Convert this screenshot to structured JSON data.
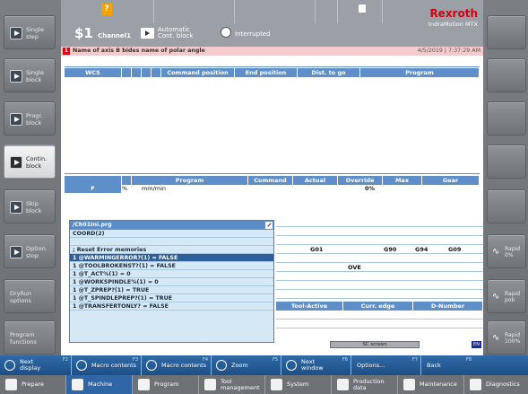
{
  "header": {
    "warning_symbol": "?",
    "channel_number": "$1",
    "channel_label": "Channel1",
    "mode_line1": "Automatic",
    "mode_line2": "Cont. block",
    "interrupted": "Interrupted",
    "brand": "Rexroth",
    "product": "IndraMotion MTX"
  },
  "alarm": {
    "mark": "1",
    "message": "Name of axis B bides name of polar angle",
    "timestamp": "4/5/2019 | 7:37:29 AM"
  },
  "left_softkeys": [
    {
      "label": "Single\nstep",
      "active": false
    },
    {
      "label": "Single\nblock",
      "active": false
    },
    {
      "label": "Progr.\nblock",
      "active": false
    },
    {
      "label": "Contin.\nblock",
      "active": true
    },
    {
      "label": "Skip\nblock",
      "active": false
    },
    {
      "label": "Option.\nstop",
      "active": false
    },
    {
      "label": "DryRun\noptions",
      "active": false
    },
    {
      "label": "Program\nfunctions",
      "active": false
    }
  ],
  "right_softkeys": [
    {
      "label": ""
    },
    {
      "label": ""
    },
    {
      "label": ""
    },
    {
      "label": ""
    },
    {
      "label": ""
    },
    {
      "label": "Rapid\n0%"
    },
    {
      "label": "Rapid\npob"
    },
    {
      "label": "Rapid\n100%"
    }
  ],
  "position_table": {
    "headers": [
      "WCS",
      "",
      "",
      "",
      "",
      "Command position",
      "End position",
      "Dist. to go",
      "Program"
    ]
  },
  "feed_table": {
    "headers": [
      "",
      "",
      "Program",
      "Command",
      "Actual",
      "Override",
      "Max",
      "Gear"
    ],
    "row": {
      "label": "F",
      "unit_pct": "%",
      "unit": "mm/min",
      "max": "0%"
    }
  },
  "program_window": {
    "title": "/Ch01Ini.prg",
    "lines": [
      "COORD(2)",
      "",
      "; Reset Error memories",
      "1 @WARMINGERROR?(1) = FALSE",
      "1 @TOOLBROKENST?(1)  = FALSE",
      "1 @T_ACT%(1) = 0",
      "1 @WORKSPINDLE%(1) = 0",
      "1 @T_ZPREP?(1) = TRUE",
      "1 @T_SPINDLEPREP?(1) = TRUE",
      "1 @TRANSFERTONLY? = FALSE"
    ],
    "selected_index": 3
  },
  "gcodes": {
    "g01": "G01",
    "g90": "G90",
    "g94": "G94",
    "g09": "G09",
    "ove": "OVE"
  },
  "tool_table": {
    "headers": [
      "Tool-Active",
      "Curr. edge",
      "D-Number"
    ]
  },
  "status": {
    "screen": "SC screen",
    "lang": "EN"
  },
  "hsoftkeys": [
    {
      "label": "Next\ndisplay",
      "fkey": "F2"
    },
    {
      "label": "Macro contents",
      "fkey": "F3"
    },
    {
      "label": "Macro contents",
      "fkey": "F4"
    },
    {
      "label": "Zoom",
      "fkey": "F5"
    },
    {
      "label": "Next\nwindow",
      "fkey": "F6"
    },
    {
      "label": "Options...",
      "fkey": "F7"
    },
    {
      "label": "Back",
      "fkey": "F8"
    }
  ],
  "nav": [
    {
      "label": "Prepare",
      "active": false
    },
    {
      "label": "Machine",
      "active": true
    },
    {
      "label": "Program",
      "active": false
    },
    {
      "label": "Tool\nmanagement",
      "active": false
    },
    {
      "label": "System",
      "active": false
    },
    {
      "label": "Production\ndata",
      "active": false
    },
    {
      "label": "Maintenance",
      "active": false
    },
    {
      "label": "Diagnostics",
      "active": false
    }
  ]
}
